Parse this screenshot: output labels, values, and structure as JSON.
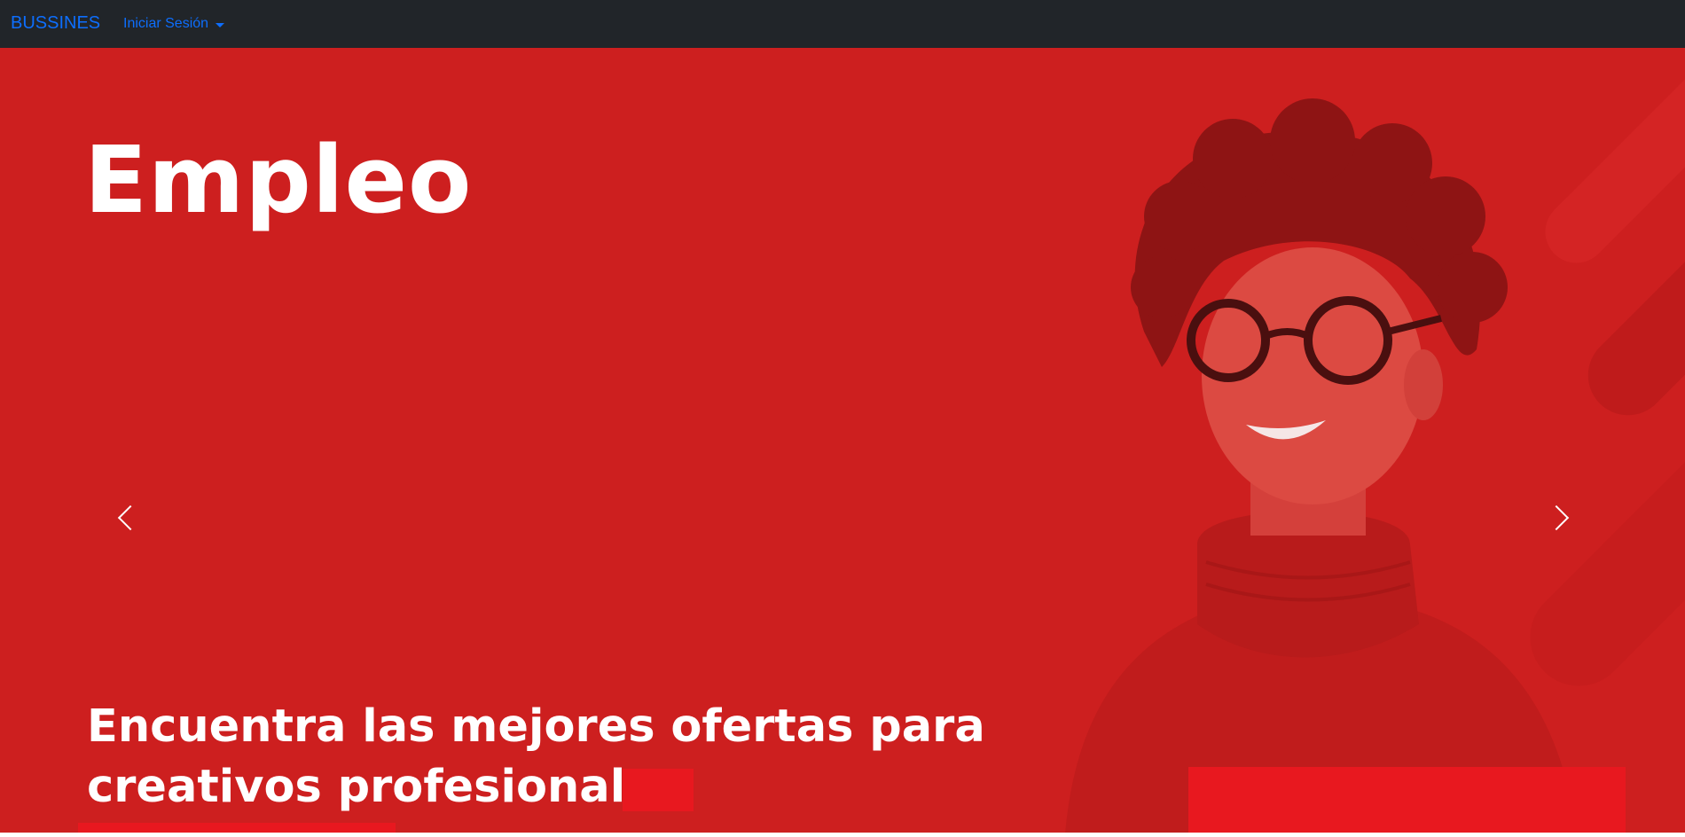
{
  "navbar": {
    "brand": "BUSSINES",
    "dropdown_label": "Iniciar Sesión",
    "background": "#212529",
    "link_color": "#0d6efd"
  },
  "hero": {
    "title": "Empleo",
    "subtitle": "Encuentra las mejores ofertas para creativos profesionales",
    "background": "#cd1f1f",
    "accent_color": "#e8181f",
    "prev_icon": "chevron-left-icon",
    "next_icon": "chevron-right-icon"
  }
}
